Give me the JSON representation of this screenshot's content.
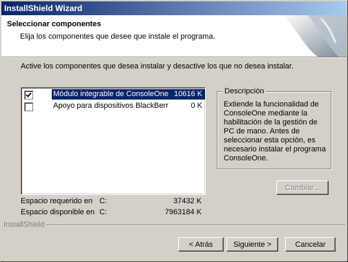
{
  "window": {
    "title": "InstallShield Wizard"
  },
  "header": {
    "title": "Seleccionar componentes",
    "subtitle": "Elija los componentes que desee que instale el programa."
  },
  "instruction": "Active los componentes que desea instalar y desactive los que no desea instalar.",
  "components": [
    {
      "label": "Módulo integrable de ConsoleOne",
      "size": "10616 K",
      "checked": true,
      "selected": true
    },
    {
      "label": "Apoyo para dispositivos BlackBerr",
      "size": "0 K",
      "checked": false,
      "selected": false
    }
  ],
  "description": {
    "legend": "Descripción",
    "text": "Extiende la funcionalidad de ConsoleOne mediante la habilitación de la gestión de PC de mano. Antes de seleccionar esta opción, es necesario instalar el programa ConsoleOne."
  },
  "change_button": "Cambiar...",
  "space": [
    {
      "label": "Espacio requerido en",
      "drive": "C:",
      "value": "37432 K"
    },
    {
      "label": "Espacio disponible en",
      "drive": "C:",
      "value": "7963184 K"
    }
  ],
  "brand": "InstallShield",
  "buttons": {
    "back": "< Atrás",
    "next": "Siguiente >",
    "cancel": "Cancelar"
  }
}
